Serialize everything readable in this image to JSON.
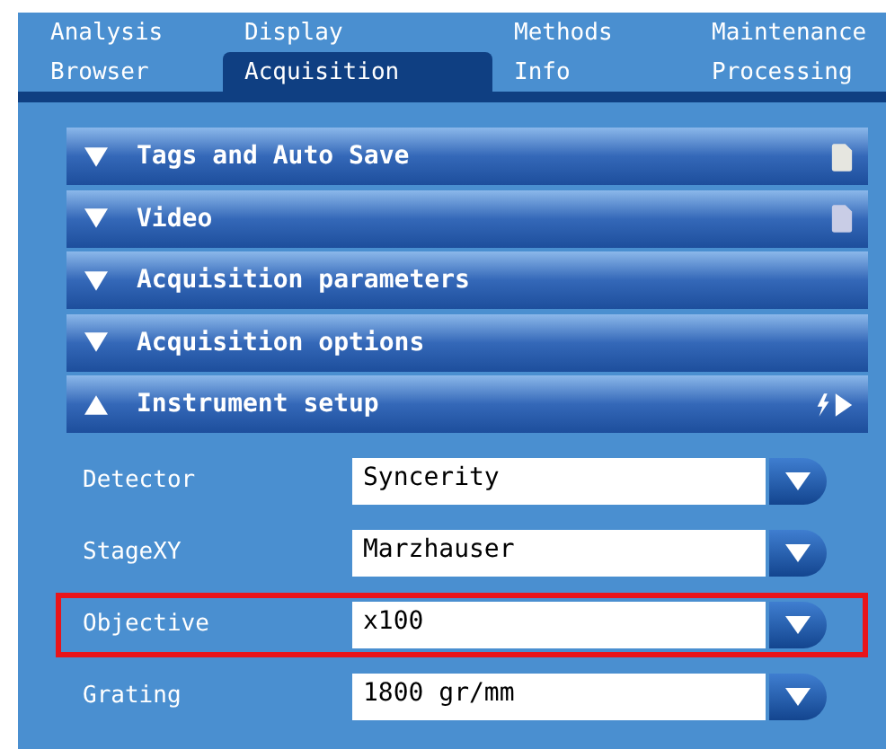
{
  "tab_rows": [
    [
      {
        "label": "Analysis",
        "selected": false
      },
      {
        "label": "Display",
        "selected": false
      },
      {
        "label": "Methods",
        "selected": false
      },
      {
        "label": "Maintenance",
        "selected": false
      }
    ],
    [
      {
        "label": "Browser",
        "selected": false
      },
      {
        "label": "Acquisition",
        "selected": true
      },
      {
        "label": "Info",
        "selected": false
      },
      {
        "label": "Processing",
        "selected": false
      }
    ]
  ],
  "sections": [
    {
      "title": "Tags and Auto Save",
      "expanded": false,
      "kind": "note"
    },
    {
      "title": "Video",
      "expanded": false,
      "kind": "note"
    },
    {
      "title": "Acquisition parameters",
      "expanded": false,
      "kind": "plain"
    },
    {
      "title": "Acquisition options",
      "expanded": false,
      "kind": "plain"
    },
    {
      "title": "Instrument setup",
      "expanded": true,
      "kind": "run"
    }
  ],
  "fields": [
    {
      "label": "Detector",
      "value": "Syncerity",
      "highlighted": false
    },
    {
      "label": "StageXY",
      "value": "Marzhauser",
      "highlighted": false
    },
    {
      "label": "Objective",
      "value": "x100",
      "highlighted": true
    },
    {
      "label": "Grating",
      "value": "1800 gr/mm",
      "highlighted": false
    }
  ]
}
